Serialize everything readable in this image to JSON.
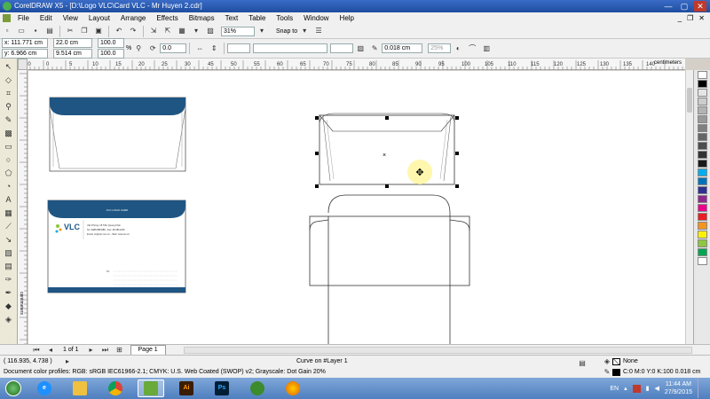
{
  "window": {
    "title": "CorelDRAW X5 - [D:\\Logo VLC\\Card VLC - Mr Huyen 2.cdr]",
    "minimize": "—",
    "maximize": "▢",
    "close": "✕"
  },
  "menu": [
    "File",
    "Edit",
    "View",
    "Layout",
    "Arrange",
    "Effects",
    "Bitmaps",
    "Text",
    "Table",
    "Tools",
    "Window",
    "Help"
  ],
  "mdi_controls": {
    "minimize": "_",
    "restore": "❐",
    "close": "✕"
  },
  "toolbar1": {
    "zoom": "31%",
    "snap_to": "Snap to"
  },
  "toolbar2": {
    "x": "x: 111.771 cm",
    "y": "y: 6.966 cm",
    "width": "22.0 cm",
    "height": "9.514 cm",
    "scale_w": "100.0",
    "scale_h": "100.0",
    "scale_unit": "%",
    "angle": "0.0",
    "outline": "0.018 cm",
    "opacity": "25%"
  },
  "ruler_h": {
    "ticks": [
      "-10",
      "0",
      "5",
      "10",
      "15",
      "20",
      "25",
      "30",
      "45",
      "50",
      "55",
      "60",
      "65",
      "70",
      "75",
      "80",
      "85",
      "90",
      "95",
      "100",
      "105",
      "110",
      "115",
      "120",
      "125",
      "130",
      "135",
      "140"
    ],
    "unit": "centimeters"
  },
  "ruler_v": {
    "unit": "centimeters"
  },
  "card": {
    "brand": "VLC",
    "header_text": "VLC LOGO CARD",
    "lines": [
      "Văn Phòng: 18 Trần Quang Khải",
      "Tel: 0988 888 888 - Fax: 08 3812345",
      "Email: vlc@vlc.com.vn - Web: www.vlc.vn"
    ],
    "to_label": "To:"
  },
  "pagebar": {
    "page_count": "1 of 1",
    "page_tab": "Page 1"
  },
  "status": {
    "coords": "( 116.935, 4.738 )",
    "object": "Curve on #Layer 1",
    "fill": "None",
    "outline": "C:0 M:0 Y:0 K:100  0.018 cm",
    "profile": "Document color profiles: RGB: sRGB IEC61966-2.1; CMYK: U.S. Web Coated (SWOP) v2; Grayscale: Dot Gain 20%"
  },
  "palette_colors": [
    "#ffffff",
    "#000000",
    "#e5e5e5",
    "#cccccc",
    "#b3b3b3",
    "#999999",
    "#808080",
    "#666666",
    "#4d4d4d",
    "#333333",
    "#1a1a1a",
    "#00aeef",
    "#0072bc",
    "#2e3192",
    "#92278f",
    "#ec008c",
    "#ed1c24",
    "#f7941d",
    "#fff200",
    "#8dc63f",
    "#00a651",
    "#ffffff"
  ],
  "taskbar": {
    "language": "EN",
    "time": "11:44 AM",
    "date": "27/9/2015",
    "apps": [
      "ie-icon",
      "explorer-icon",
      "chrome-icon",
      "coreldraw-icon",
      "illustrator-icon",
      "photoshop-icon",
      "corel-green-icon",
      "firefox-icon"
    ],
    "ai": "Ai",
    "ps": "Ps"
  },
  "colors": {
    "accent_blue": "#1f5582",
    "title_blue": "#2a5caa"
  }
}
